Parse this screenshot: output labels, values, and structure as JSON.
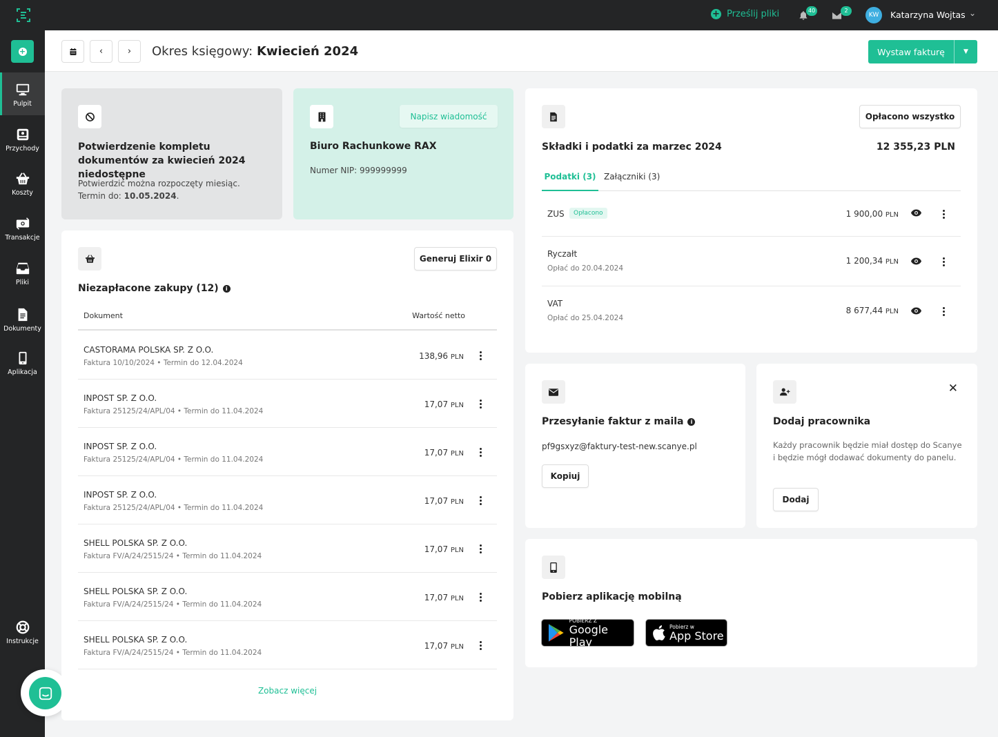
{
  "topbar": {
    "upload_label": "Prześlij pliki",
    "notifications_count": "40",
    "messages_count": "2",
    "user_initials": "KW",
    "user_name": "Katarzyna Wojtas"
  },
  "sidebar": {
    "items": [
      {
        "label": "Pulpit",
        "icon": "monitor-icon"
      },
      {
        "label": "Przychody",
        "icon": "cash-register-icon"
      },
      {
        "label": "Koszty",
        "icon": "basket-icon"
      },
      {
        "label": "Transakcje",
        "icon": "money-icon"
      },
      {
        "label": "Pliki",
        "icon": "inbox-icon"
      },
      {
        "label": "Dokumenty",
        "icon": "document-icon"
      },
      {
        "label": "Aplikacja",
        "icon": "mobile-icon"
      },
      {
        "label": "Instrukcje",
        "icon": "lifebuoy-icon"
      }
    ]
  },
  "header": {
    "period_prefix": "Okres księgowy:",
    "period_value": "Kwiecień 2024",
    "issue_invoice": "Wystaw fakturę"
  },
  "confirm_card": {
    "title": "Potwierdzenie kompletu dokumentów za kwiecień 2024 niedostępne",
    "line1": "Potwierdzić można rozpoczęty miesiąc.",
    "deadline_prefix": "Termin do:",
    "deadline_value": "10.05.2024",
    "deadline_suffix": "."
  },
  "office_card": {
    "message_button": "Napisz wiadomość",
    "name": "Biuro Rachunkowe RAX",
    "nip": "Numer NIP: 999999999"
  },
  "purchases": {
    "elixir_button": "Generuj Elixir 0",
    "title": "Niezapłacone zakupy (12)",
    "col_document": "Dokument",
    "col_value": "Wartość netto",
    "rows": [
      {
        "name": "CASTORAMA POLSKA SP. Z O.O.",
        "sub": "Faktura 10/10/2024  •  Termin do 12.04.2024",
        "amount": "138,96",
        "currency": "PLN"
      },
      {
        "name": "INPOST SP. Z O.O.",
        "sub": "Faktura 25125/24/APL/04  •  Termin do 11.04.2024",
        "amount": "17,07",
        "currency": "PLN"
      },
      {
        "name": "INPOST SP. Z O.O.",
        "sub": "Faktura 25125/24/APL/04  •  Termin do 11.04.2024",
        "amount": "17,07",
        "currency": "PLN"
      },
      {
        "name": "INPOST SP. Z O.O.",
        "sub": "Faktura 25125/24/APL/04  •  Termin do 11.04.2024",
        "amount": "17,07",
        "currency": "PLN"
      },
      {
        "name": "SHELL POLSKA SP. Z O.O.",
        "sub": "Faktura FV/A/24/2515/24  •  Termin do 11.04.2024",
        "amount": "17,07",
        "currency": "PLN"
      },
      {
        "name": "SHELL POLSKA SP. Z O.O.",
        "sub": "Faktura FV/A/24/2515/24  •  Termin do 11.04.2024",
        "amount": "17,07",
        "currency": "PLN"
      },
      {
        "name": "SHELL POLSKA SP. Z O.O.",
        "sub": "Faktura FV/A/24/2515/24  •  Termin do 11.04.2024",
        "amount": "17,07",
        "currency": "PLN"
      }
    ],
    "see_more": "Zobacz więcej"
  },
  "taxes": {
    "paid_all_button": "Opłacono wszystko",
    "title": "Składki i podatki za marzec 2024",
    "total": "12 355,23 PLN",
    "tab_taxes": "Podatki (3)",
    "tab_attachments": "Załączniki (3)",
    "rows": [
      {
        "name": "ZUS",
        "badge": "Opłacono",
        "sub": "",
        "amount": "1 900,00",
        "currency": "PLN"
      },
      {
        "name": "Ryczałt",
        "badge": "",
        "sub": "Opłać do 20.04.2024",
        "amount": "1 200,34",
        "currency": "PLN"
      },
      {
        "name": "VAT",
        "badge": "",
        "sub": "Opłać do 25.04.2024",
        "amount": "8 677,44",
        "currency": "PLN"
      }
    ]
  },
  "email_card": {
    "title": "Przesyłanie faktur z maila",
    "address": "pf9gsxyz@faktury-test-new.scanye.pl",
    "copy_button": "Kopiuj"
  },
  "employee_card": {
    "title": "Dodaj pracownika",
    "description": "Każdy pracownik będzie miał dostęp do Scanye i będzie mógł dodawać dokumenty do panelu.",
    "add_button": "Dodaj"
  },
  "mobile_card": {
    "title": "Pobierz aplikację mobilną",
    "google_small": "POBIERZ Z",
    "google_big": "Google Play",
    "apple_small": "Pobierz w",
    "apple_big": "App Store"
  },
  "colors": {
    "accent": "#1fbf95",
    "dark": "#242526"
  }
}
